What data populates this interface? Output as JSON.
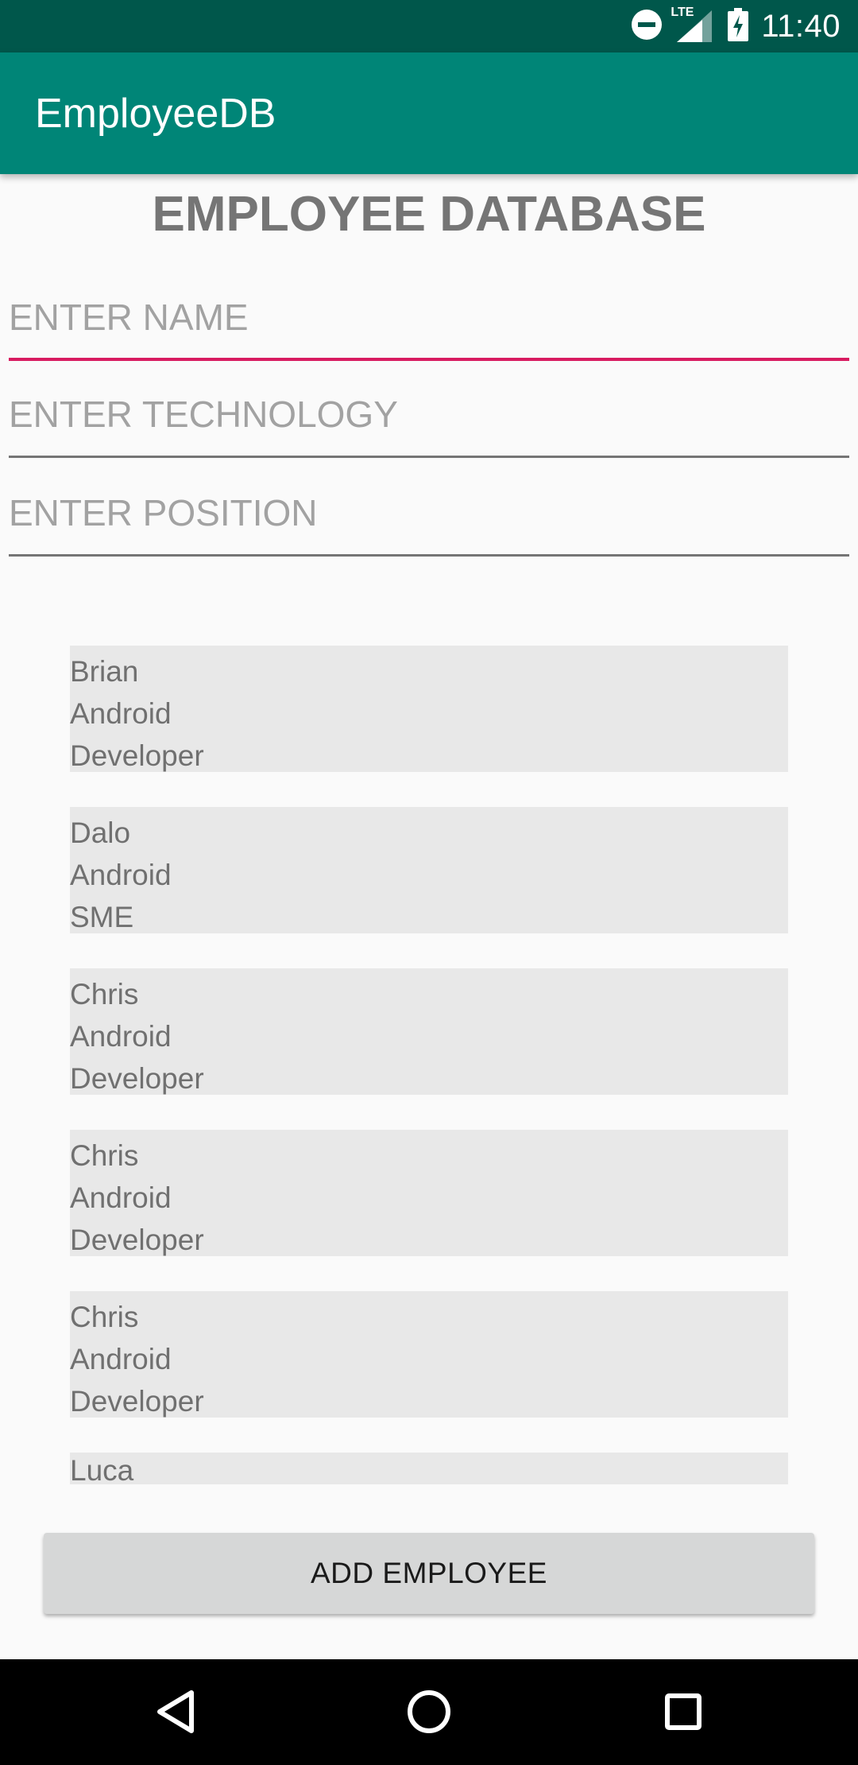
{
  "status_bar": {
    "time": "11:40",
    "network_label": "LTE",
    "icons": [
      "do-not-disturb-icon",
      "lte-signal-icon",
      "battery-charging-icon"
    ]
  },
  "app_bar": {
    "title": "EmployeeDB"
  },
  "main": {
    "heading": "EMPLOYEE DATABASE",
    "fields": {
      "name": {
        "placeholder": "ENTER NAME",
        "value": ""
      },
      "technology": {
        "placeholder": "ENTER TECHNOLOGY",
        "value": ""
      },
      "position": {
        "placeholder": "ENTER POSITION",
        "value": ""
      }
    },
    "employees": [
      {
        "name": "Brian",
        "technology": "Android",
        "position": "Developer"
      },
      {
        "name": "Dalo",
        "technology": "Android",
        "position": "SME"
      },
      {
        "name": "Chris",
        "technology": "Android",
        "position": "Developer"
      },
      {
        "name": "Chris",
        "technology": "Android",
        "position": "Developer"
      },
      {
        "name": "Chris",
        "technology": "Android",
        "position": "Developer"
      },
      {
        "name": "Luca",
        "technology": "",
        "position": ""
      }
    ],
    "add_button_label": "ADD EMPLOYEE"
  },
  "nav_bar": {
    "icons": [
      "back-icon",
      "home-icon",
      "recents-icon"
    ]
  },
  "colors": {
    "status_bar": "#00574b",
    "app_bar": "#008577",
    "accent": "#d81b60"
  }
}
